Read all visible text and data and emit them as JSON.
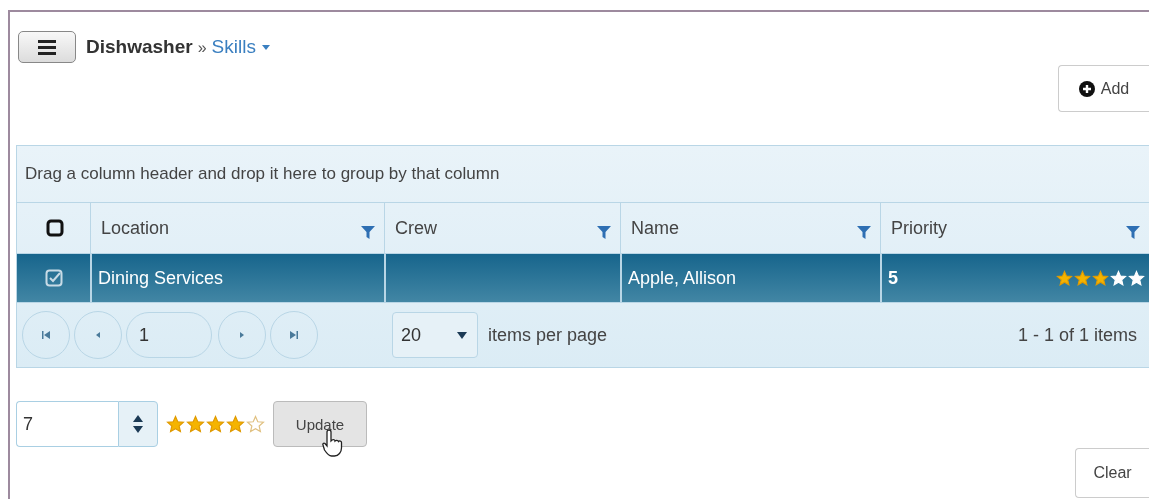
{
  "breadcrumb": {
    "parent": "Dishwasher",
    "separator": "»",
    "current": "Skills"
  },
  "add_button": "Add",
  "group_hint": "Drag a column header and drop it here to group by that column",
  "header_checkbox": {
    "checked": false
  },
  "columns": [
    "Location",
    "Crew",
    "Name",
    "Priority"
  ],
  "rows": [
    {
      "selected": true,
      "checked": true,
      "location": "Dining Services",
      "name": "Apple, Allison",
      "priority": "5",
      "stars": 3
    }
  ],
  "pager": {
    "page": "1",
    "page_size": "20",
    "page_size_label": "items per page",
    "summary": "1 - 1 of 1 items"
  },
  "editor": {
    "value": "7",
    "stars": 4,
    "update_button": "Update"
  },
  "clear_button": "Clear"
}
